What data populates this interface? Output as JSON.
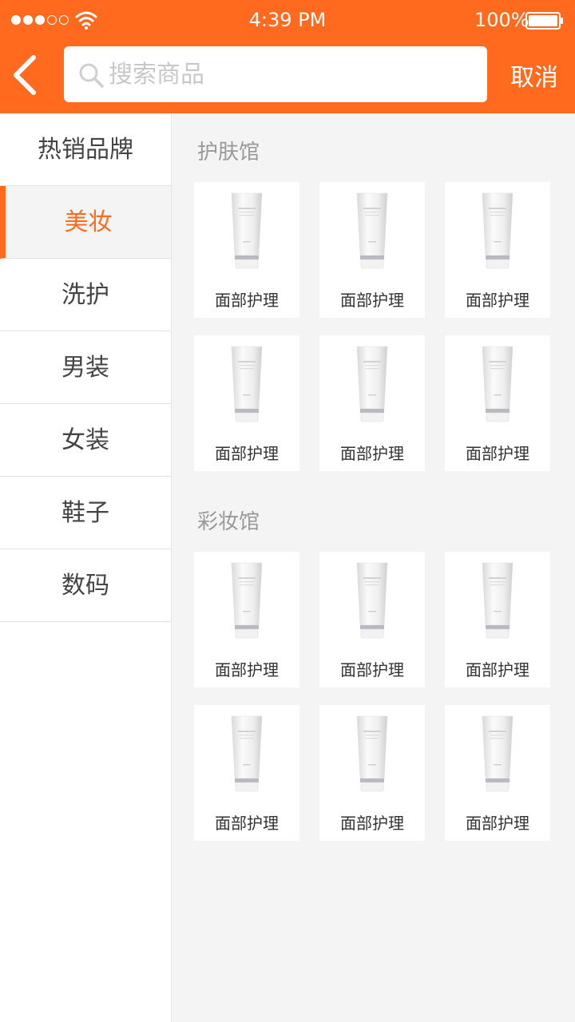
{
  "status_bar": {
    "time": "4:39 PM",
    "battery": "100%",
    "signal_filled": 3,
    "signal_total": 5,
    "wifi_icon": "wifi-icon",
    "battery_icon": "battery-icon"
  },
  "header": {
    "back_icon": "chevron-left-icon",
    "search": {
      "placeholder": "搜索商品",
      "value": "",
      "icon": "search-icon"
    },
    "cancel_label": "取消",
    "accent": "#ff6a1e"
  },
  "sidebar": {
    "items": [
      {
        "label": "热销品牌",
        "active": false
      },
      {
        "label": "美妆",
        "active": true
      },
      {
        "label": "洗护",
        "active": false
      },
      {
        "label": "男装",
        "active": false
      },
      {
        "label": "女装",
        "active": false
      },
      {
        "label": "鞋子",
        "active": false
      },
      {
        "label": "数码",
        "active": false
      }
    ]
  },
  "sections": [
    {
      "title": "护肤馆",
      "products": [
        {
          "label": "面部护理"
        },
        {
          "label": "面部护理"
        },
        {
          "label": "面部护理"
        },
        {
          "label": "面部护理"
        },
        {
          "label": "面部护理"
        },
        {
          "label": "面部护理"
        }
      ]
    },
    {
      "title": "彩妆馆",
      "products": [
        {
          "label": "面部护理"
        },
        {
          "label": "面部护理"
        },
        {
          "label": "面部护理"
        },
        {
          "label": "面部护理"
        },
        {
          "label": "面部护理"
        },
        {
          "label": "面部护理"
        }
      ]
    }
  ]
}
